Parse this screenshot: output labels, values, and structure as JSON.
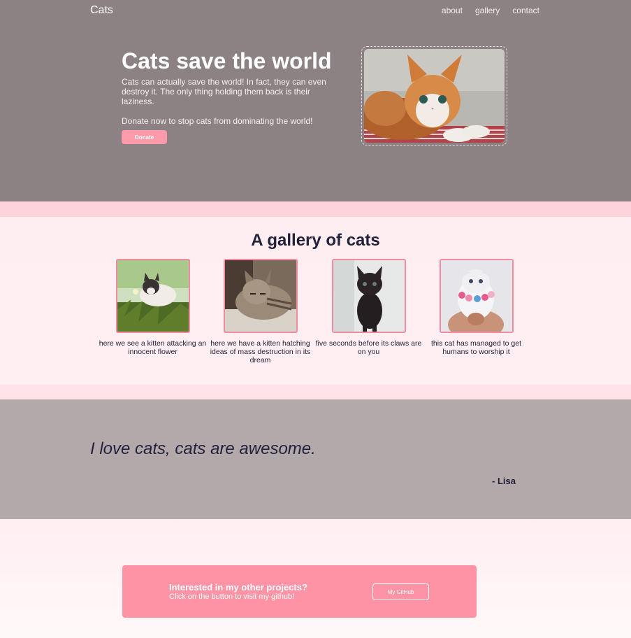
{
  "nav": {
    "brand": "Cats",
    "links": [
      "about",
      "gallery",
      "contact"
    ]
  },
  "hero": {
    "title": "Cats save the world",
    "text": "Cats can actually save the world! In fact, they can even destroy it. The only thing holding them back is their laziness.",
    "cta_text": "Donate now to stop cats from dominating the world!",
    "donate_label": "Donate"
  },
  "gallery": {
    "title": "A gallery of cats",
    "items": [
      {
        "caption": "here we see a kitten attacking an innocent flower"
      },
      {
        "caption": "here we have a kitten hatching ideas of mass destruction in its dream"
      },
      {
        "caption": "five seconds before its claws are on you"
      },
      {
        "caption": "this cat has managed to get humans to worship it"
      }
    ]
  },
  "quote": {
    "text": "I love cats, cats are awesome.",
    "author": "- Lisa"
  },
  "cta": {
    "title": "Interested in my other projects?",
    "subtitle": "Click on the button to visit my github!",
    "button_label": "My GitHub"
  },
  "colors": {
    "hero_bg": "#8c8284",
    "accent": "#ff93a6",
    "quote_bg": "#b3a8aa",
    "page_bg": "#ffeef1"
  }
}
